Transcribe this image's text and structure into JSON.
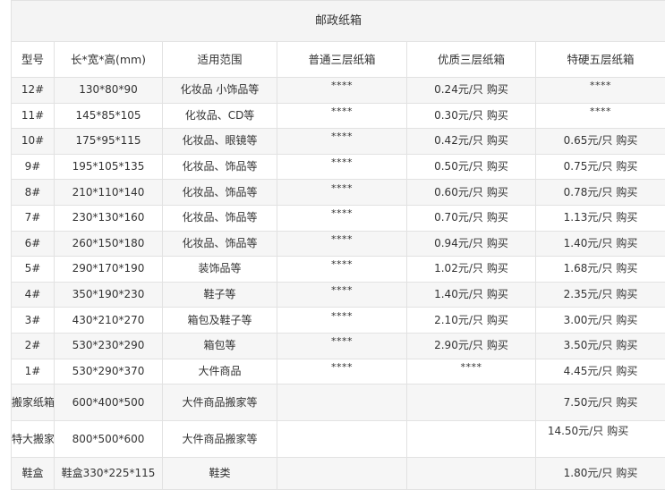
{
  "title": "邮政纸箱",
  "headers": {
    "model": "型号",
    "size": "长*宽*高(mm)",
    "usage": "适用范围",
    "normal": "普通三层纸箱",
    "quality": "优质三层纸箱",
    "hard": "特硬五层纸箱"
  },
  "buy_label": "购买",
  "rows": [
    {
      "model": "12#",
      "size": "130*80*90",
      "usage": "化妆品 小饰品等",
      "normal": "****",
      "quality": "0.24元/只",
      "hard": "****"
    },
    {
      "model": "11#",
      "size": "145*85*105",
      "usage": "化妆品、CD等",
      "normal": "****",
      "quality": "0.30元/只",
      "hard": "****"
    },
    {
      "model": "10#",
      "size": "175*95*115",
      "usage": "化妆品、眼镜等",
      "normal": "****",
      "quality": "0.42元/只",
      "hard": "0.65元/只"
    },
    {
      "model": "9#",
      "size": "195*105*135",
      "usage": "化妆品、饰品等",
      "normal": "****",
      "quality": "0.50元/只",
      "hard": "0.75元/只"
    },
    {
      "model": "8#",
      "size": "210*110*140",
      "usage": "化妆品、饰品等",
      "normal": "****",
      "quality": "0.60元/只",
      "hard": "0.78元/只"
    },
    {
      "model": "7#",
      "size": "230*130*160",
      "usage": "化妆品、饰品等",
      "normal": "****",
      "quality": "0.70元/只",
      "hard": "1.13元/只"
    },
    {
      "model": "6#",
      "size": "260*150*180",
      "usage": "化妆品、饰品等",
      "normal": "****",
      "quality": "0.94元/只",
      "hard": "1.40元/只"
    },
    {
      "model": "5#",
      "size": "290*170*190",
      "usage": "装饰品等",
      "normal": "****",
      "quality": "1.02元/只",
      "hard": "1.68元/只"
    },
    {
      "model": "4#",
      "size": "350*190*230",
      "usage": "鞋子等",
      "normal": "****",
      "quality": "1.40元/只",
      "hard": "2.35元/只"
    },
    {
      "model": "3#",
      "size": "430*210*270",
      "usage": "箱包及鞋子等",
      "normal": "****",
      "quality": "2.10元/只",
      "hard": "3.00元/只"
    },
    {
      "model": "2#",
      "size": "530*230*290",
      "usage": "箱包等",
      "normal": "****",
      "quality": "2.90元/只",
      "hard": "3.50元/只"
    },
    {
      "model": "1#",
      "size": "530*290*370",
      "usage": "大件商品",
      "normal": "****",
      "quality": "****",
      "hard": "4.45元/只"
    },
    {
      "model": "搬家纸箱",
      "size": "600*400*500",
      "usage": "大件商品搬家等",
      "normal": "",
      "quality": "",
      "hard": "7.50元/只"
    },
    {
      "model": "特大搬家箱",
      "size": "800*500*600",
      "usage": "大件商品搬家等",
      "normal": "",
      "quality": "",
      "hard": "14.50元/只"
    },
    {
      "model": "鞋盒",
      "size": "鞋盒330*225*115",
      "usage": "鞋类",
      "normal": "",
      "quality": "",
      "hard": "1.80元/只"
    }
  ]
}
